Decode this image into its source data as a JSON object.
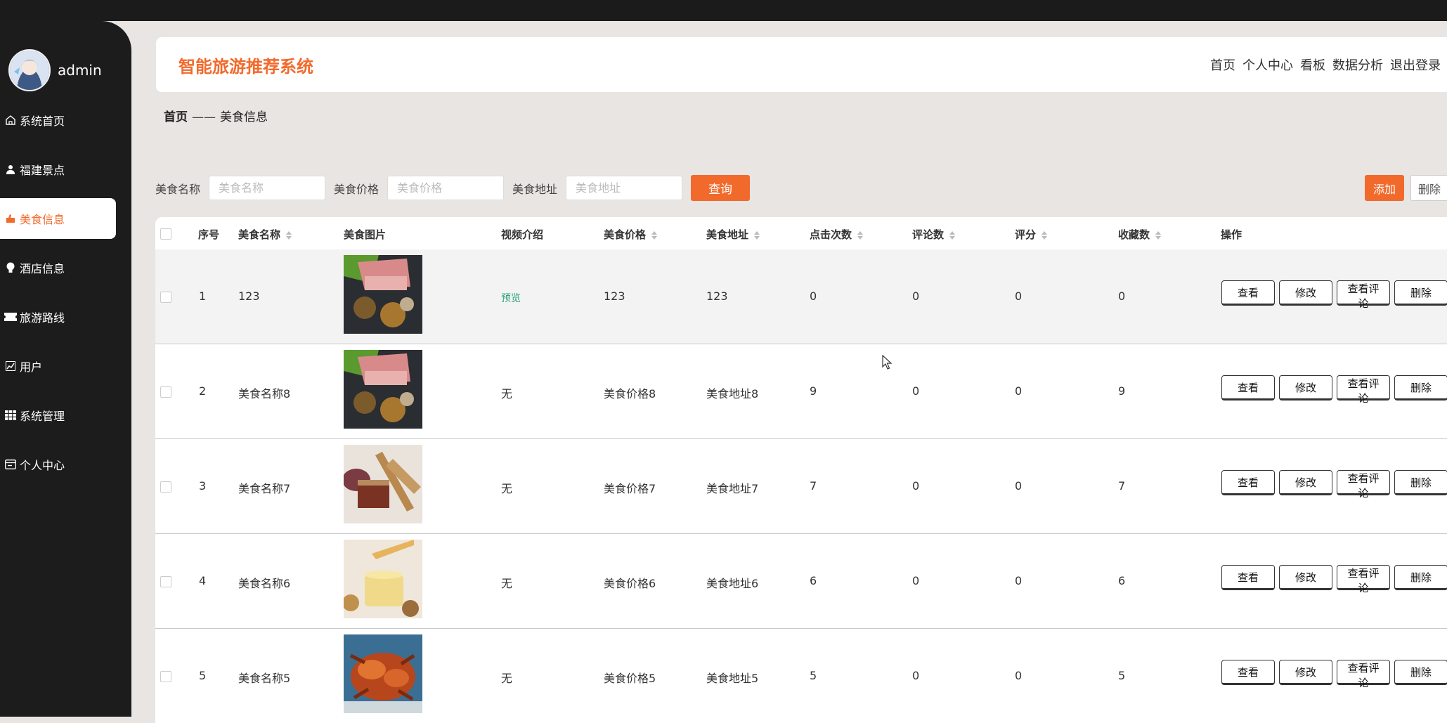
{
  "app": {
    "title": "智能旅游推荐系统"
  },
  "user": {
    "name": "admin"
  },
  "nav": [
    "首页",
    "个人中心",
    "看板",
    "数据分析",
    "退出登录"
  ],
  "sidebar": {
    "items": [
      {
        "label": "系统首页",
        "icon": "home-icon"
      },
      {
        "label": "福建景点",
        "icon": "user-icon"
      },
      {
        "label": "美食信息",
        "icon": "food-icon",
        "active": true
      },
      {
        "label": "酒店信息",
        "icon": "bulb-icon"
      },
      {
        "label": "旅游路线",
        "icon": "ticket-icon"
      },
      {
        "label": "用户",
        "icon": "chart-icon"
      },
      {
        "label": "系统管理",
        "icon": "grid-icon"
      },
      {
        "label": "个人中心",
        "icon": "card-icon"
      }
    ]
  },
  "breadcrumb": {
    "home": "首页",
    "sep": "——",
    "current": "美食信息"
  },
  "search": {
    "name_label": "美食名称",
    "name_placeholder": "美食名称",
    "price_label": "美食价格",
    "price_placeholder": "美食价格",
    "address_label": "美食地址",
    "address_placeholder": "美食地址",
    "query_button": "查询"
  },
  "actions": {
    "add": "添加",
    "delete": "删除"
  },
  "table": {
    "columns": [
      "序号",
      "美食名称",
      "美食图片",
      "视频介绍",
      "美食价格",
      "美食地址",
      "点击次数",
      "评论数",
      "评分",
      "收藏数",
      "操作"
    ],
    "row_actions": [
      "查看",
      "修改",
      "查看评论",
      "删除"
    ],
    "rows": [
      {
        "index": "1",
        "name": "123",
        "video": "预览",
        "price": "123",
        "address": "123",
        "clicks": "0",
        "comments": "0",
        "score": "0",
        "favorites": "0"
      },
      {
        "index": "2",
        "name": "美食名称8",
        "video": "无",
        "price": "美食价格8",
        "address": "美食地址8",
        "clicks": "9",
        "comments": "0",
        "score": "0",
        "favorites": "9"
      },
      {
        "index": "3",
        "name": "美食名称7",
        "video": "无",
        "price": "美食价格7",
        "address": "美食地址7",
        "clicks": "7",
        "comments": "0",
        "score": "0",
        "favorites": "7"
      },
      {
        "index": "4",
        "name": "美食名称6",
        "video": "无",
        "price": "美食价格6",
        "address": "美食地址6",
        "clicks": "6",
        "comments": "0",
        "score": "0",
        "favorites": "6"
      },
      {
        "index": "5",
        "name": "美食名称5",
        "video": "无",
        "price": "美食价格5",
        "address": "美食地址5",
        "clicks": "5",
        "comments": "0",
        "score": "0",
        "favorites": "5"
      }
    ]
  },
  "colors": {
    "accent": "#f26a2b",
    "sidebar": "#1c1c1c",
    "background": "#e9e5e2",
    "preview": "#2aa47a"
  }
}
